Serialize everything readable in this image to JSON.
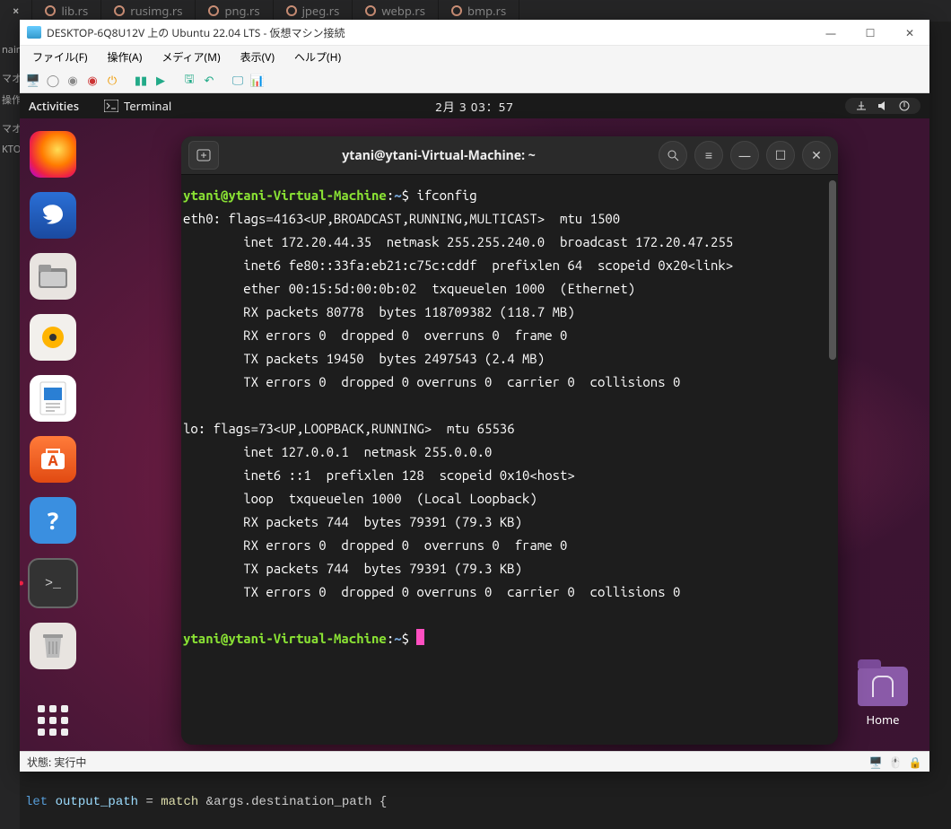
{
  "bg_editor": {
    "tabs": [
      "lib.rs",
      "rusimg.rs",
      "png.rs",
      "jpeg.rs",
      "webp.rs",
      "bmp.rs"
    ],
    "side_items": [
      "nain",
      "",
      "マオ",
      "操作",
      "",
      "マオ",
      "KTO"
    ],
    "code_let": "let",
    "code_var1": " output_path ",
    "code_eq": "= ",
    "code_match": "match",
    "code_rest": " &args.destination_path {"
  },
  "vm": {
    "title": "DESKTOP-6Q8U12V 上の Ubuntu 22.04 LTS  - 仮想マシン接続",
    "menus": [
      "ファイル(F)",
      "操作(A)",
      "メディア(M)",
      "表示(V)",
      "ヘルプ(H)"
    ],
    "status": "状態: 実行中"
  },
  "gnome": {
    "activities": "Activities",
    "app": "Terminal",
    "clock": "2月 3 03：57",
    "home": "Home"
  },
  "terminal": {
    "title": "ytani@ytani-Virtual-Machine: ~",
    "prompt_user": "ytani@ytani-Virtual-Machine",
    "prompt_sep": ":",
    "prompt_path": "~",
    "prompt_sym": "$ ",
    "cmd1": "ifconfig",
    "body": "eth0: flags=4163<UP,BROADCAST,RUNNING,MULTICAST>  mtu 1500\n        inet 172.20.44.35  netmask 255.255.240.0  broadcast 172.20.47.255\n        inet6 fe80::33fa:eb21:c75c:cddf  prefixlen 64  scopeid 0x20<link>\n        ether 00:15:5d:00:0b:02  txqueuelen 1000  (Ethernet)\n        RX packets 80778  bytes 118709382 (118.7 MB)\n        RX errors 0  dropped 0  overruns 0  frame 0\n        TX packets 19450  bytes 2497543 (2.4 MB)\n        TX errors 0  dropped 0 overruns 0  carrier 0  collisions 0\n\nlo: flags=73<UP,LOOPBACK,RUNNING>  mtu 65536\n        inet 127.0.0.1  netmask 255.0.0.0\n        inet6 ::1  prefixlen 128  scopeid 0x10<host>\n        loop  txqueuelen 1000  (Local Loopback)\n        RX packets 744  bytes 79391 (79.3 KB)\n        RX errors 0  dropped 0  overruns 0  frame 0\n        TX packets 744  bytes 79391 (79.3 KB)\n        TX errors 0  dropped 0 overruns 0  carrier 0  collisions 0\n"
  }
}
